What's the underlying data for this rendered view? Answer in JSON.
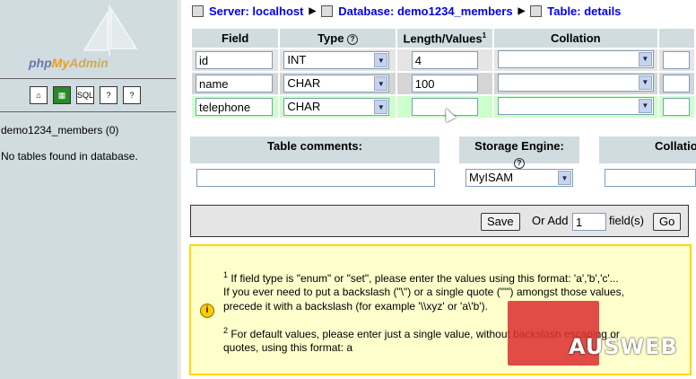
{
  "sidebar": {
    "logo_php": "php",
    "logo_my": "My",
    "logo_admin": "Admin",
    "icons": [
      "home-icon",
      "query-icon",
      "sql-icon",
      "docs-icon",
      "docs-sql-icon"
    ],
    "icon_labels": [
      "",
      "",
      "SQL",
      "",
      ""
    ],
    "database": "demo1234_members (0)",
    "no_tables": "No tables found in database."
  },
  "breadcrumb": {
    "server": "Server: localhost",
    "database": "Database: demo1234_members",
    "table": "Table: details"
  },
  "fields_table": {
    "headers": [
      "Field",
      "Type",
      "Length/Values",
      "Collation"
    ],
    "length_sup": "1",
    "rows": [
      {
        "field": "id",
        "type": "INT",
        "length": "4",
        "collation": ""
      },
      {
        "field": "name",
        "type": "CHAR",
        "length": "100",
        "collation": ""
      },
      {
        "field": "telephone",
        "type": "CHAR",
        "length": "",
        "collation": ""
      }
    ]
  },
  "table_options": {
    "comments_label": "Table comments:",
    "comments_value": "",
    "engine_label": "Storage Engine:",
    "engine_value": "MyISAM",
    "collation_label": "Collatio",
    "collation_value": ""
  },
  "save_bar": {
    "save_label": "Save",
    "or_add": "Or Add",
    "add_count": "1",
    "fields_label": "field(s)",
    "go_label": "Go"
  },
  "notes": {
    "note1_sup": "1",
    "note1_line1": " If field type is \"enum\" or \"set\", please enter the values using this format: 'a','b','c'...",
    "note1_line2": "If you ever need to put a backslash (\"\\\") or a single quote (\"'\") amongst those values,",
    "note1_line3": "precede it with a backslash (for example '\\\\xyz' or 'a\\'b').",
    "note2_sup": "2",
    "note2_line1": " For default values, please enter just a single value, without backslash escaping or",
    "note2_line2": "quotes, using this format: a"
  },
  "watermark": "AUSWEB",
  "colors": {
    "sidebar_bg": "#d0dce0",
    "link": "#0000ee",
    "row_highlight": "#ccffcc",
    "note_bg": "#ffffcc"
  }
}
